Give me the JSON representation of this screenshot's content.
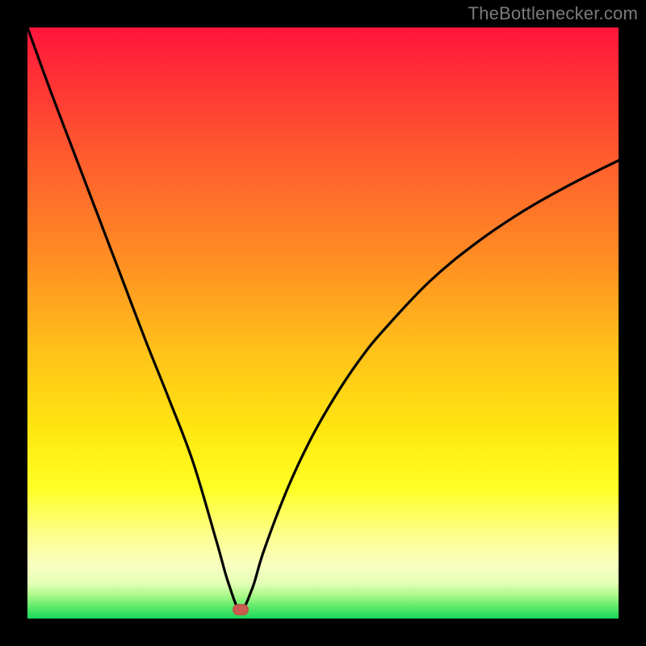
{
  "attribution": "TheBottlenecker.com",
  "colors": {
    "curve": "#000000",
    "marker": "#c95b4f",
    "frame": "#000000"
  },
  "chart_data": {
    "type": "line",
    "title": "",
    "xlabel": "",
    "ylabel": "",
    "xlim": [
      0,
      100
    ],
    "ylim": [
      0,
      100
    ],
    "legend": false,
    "grid": false,
    "annotations": [
      {
        "kind": "min-marker",
        "x": 36,
        "y": 1.5
      }
    ],
    "series": [
      {
        "name": "bottleneck-curve",
        "x": [
          0,
          4,
          8,
          12,
          16,
          20,
          24,
          28,
          32,
          34,
          36,
          38,
          40,
          44,
          48,
          52,
          56,
          60,
          68,
          76,
          84,
          92,
          100
        ],
        "y": [
          100,
          89,
          78.5,
          68,
          57.5,
          47,
          37,
          26.5,
          13,
          6,
          1.5,
          5,
          11.5,
          22,
          30.5,
          37.5,
          43.5,
          48.5,
          57,
          63.6,
          69,
          73.5,
          77.5
        ]
      }
    ]
  }
}
